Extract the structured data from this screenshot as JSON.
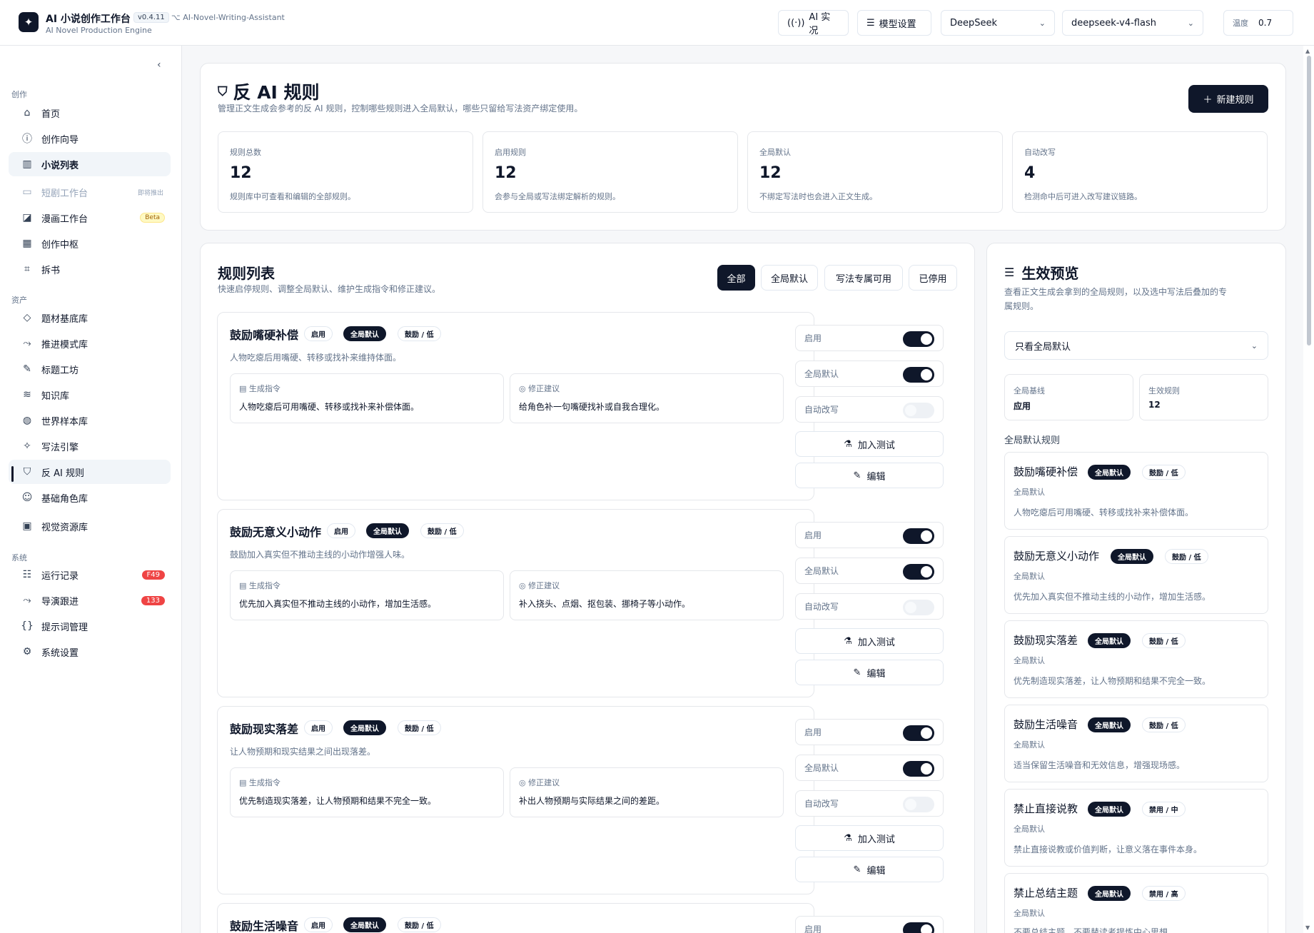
{
  "app": {
    "title": "AI 小说创作工作台",
    "version": "v0.4.11",
    "subtitle": "AI Novel Production Engine",
    "repo": "AI-Novel-Writing-Assistant"
  },
  "topbar": {
    "live_label": "AI 实况",
    "model_settings_label": "模型设置",
    "provider": "DeepSeek",
    "model": "deepseek-v4-flash",
    "temp_label": "温度",
    "temp_value": "0.7"
  },
  "sidebar": {
    "sections": {
      "create": "创作",
      "assets": "资产",
      "system": "系统"
    },
    "items": [
      {
        "label": "首页",
        "icon": "home-icon"
      },
      {
        "label": "创作向导",
        "icon": "help-circle-icon"
      },
      {
        "label": "小说列表",
        "icon": "book-open-icon",
        "active": true
      },
      {
        "label": "短剧工作台",
        "icon": "tv-icon",
        "disabled": true,
        "tag": "即将推出"
      },
      {
        "label": "漫画工作台",
        "icon": "comic-icon",
        "badge": "Beta"
      },
      {
        "label": "创作中枢",
        "icon": "grid-icon"
      },
      {
        "label": "拆书",
        "icon": "scan-icon"
      },
      {
        "label": "题材基底库",
        "icon": "tag-icon"
      },
      {
        "label": "推进模式库",
        "icon": "route-icon"
      },
      {
        "label": "标题工坊",
        "icon": "edit-icon"
      },
      {
        "label": "知识库",
        "icon": "database-icon"
      },
      {
        "label": "世界样本库",
        "icon": "globe-icon"
      },
      {
        "label": "写法引擎",
        "icon": "wand-icon"
      },
      {
        "label": "反 AI 规则",
        "icon": "shield-check-icon",
        "current": true
      },
      {
        "label": "基础角色库",
        "icon": "user-icon"
      },
      {
        "label": "视觉资源库",
        "icon": "image-icon"
      },
      {
        "label": "运行记录",
        "icon": "list-icon",
        "count": "F49"
      },
      {
        "label": "导演跟进",
        "icon": "route-icon",
        "count": "133"
      },
      {
        "label": "提示词管理",
        "icon": "braces-icon"
      },
      {
        "label": "系统设置",
        "icon": "settings-icon"
      }
    ]
  },
  "page": {
    "title": "反 AI 规则",
    "desc": "管理正文生成会参考的反 AI 规则，控制哪些规则进入全局默认，哪些只留给写法资产绑定使用。",
    "new_button": "新建规则",
    "stats": [
      {
        "label": "规则总数",
        "value": "12",
        "desc": "规则库中可查看和编辑的全部规则。"
      },
      {
        "label": "启用规则",
        "value": "12",
        "desc": "会参与全局或写法绑定解析的规则。"
      },
      {
        "label": "全局默认",
        "value": "12",
        "desc": "不绑定写法时也会进入正文生成。"
      },
      {
        "label": "自动改写",
        "value": "4",
        "desc": "检测命中后可进入改写建议链路。"
      }
    ]
  },
  "rules_list": {
    "title": "规则列表",
    "desc": "快速启停规则、调整全局默认、维护生成指令和修正建议。",
    "filters": [
      "全部",
      "全局默认",
      "写法专属可用",
      "已停用"
    ],
    "labels": {
      "gen": "生成指令",
      "fix": "修正建议",
      "enabled": "启用",
      "global": "全局默认",
      "auto": "自动改写",
      "test": "加入测试",
      "edit": "编辑"
    },
    "rules": [
      {
        "name": "鼓励嘴硬补偿",
        "status": "启用",
        "scope": "全局默认",
        "level": "鼓励 / 低",
        "desc": "人物吃瘪后用嘴硬、转移或找补来维持体面。",
        "gen": "人物吃瘪后可用嘴硬、转移或找补来补偿体面。",
        "fix": "给角色补一句嘴硬找补或自我合理化。"
      },
      {
        "name": "鼓励无意义小动作",
        "status": "启用",
        "scope": "全局默认",
        "level": "鼓励 / 低",
        "desc": "鼓励加入真实但不推动主线的小动作增强人味。",
        "gen": "优先加入真实但不推动主线的小动作，增加生活感。",
        "fix": "补入挠头、点烟、抠包装、挪椅子等小动作。"
      },
      {
        "name": "鼓励现实落差",
        "status": "启用",
        "scope": "全局默认",
        "level": "鼓励 / 低",
        "desc": "让人物预期和现实结果之间出现落差。",
        "gen": "优先制造现实落差，让人物预期和结果不完全一致。",
        "fix": "补出人物预期与实际结果之间的差距。"
      },
      {
        "name": "鼓励生活噪音",
        "status": "启用",
        "scope": "全局默认",
        "level": "鼓励 / 低"
      }
    ]
  },
  "preview": {
    "title": "生效预览",
    "desc_line1": "查看正文生成会拿到的全局规则，以及选中写法后叠加的专",
    "desc_line2": "属规则。",
    "select_value": "只看全局默认",
    "stats": [
      {
        "label": "全局基线",
        "value": "应用"
      },
      {
        "label": "生效规则",
        "value": "12"
      }
    ],
    "subtitle": "全局默认规则",
    "cards": [
      {
        "name": "鼓励嘴硬补偿",
        "scope": "全局默认",
        "level": "鼓励 / 低",
        "category": "全局默认",
        "text": "人物吃瘪后可用嘴硬、转移或找补来补偿体面。"
      },
      {
        "name": "鼓励无意义小动作",
        "scope": "全局默认",
        "level": "鼓励 / 低",
        "category": "全局默认",
        "text": "优先加入真实但不推动主线的小动作，增加生活感。"
      },
      {
        "name": "鼓励现实落差",
        "scope": "全局默认",
        "level": "鼓励 / 低",
        "category": "全局默认",
        "text": "优先制造现实落差，让人物预期和结果不完全一致。"
      },
      {
        "name": "鼓励生活噪音",
        "scope": "全局默认",
        "level": "鼓励 / 低",
        "category": "全局默认",
        "text": "适当保留生活噪音和无效信息，增强现场感。"
      },
      {
        "name": "禁止直接说教",
        "scope": "全局默认",
        "level": "禁用 / 中",
        "category": "全局默认",
        "text": "禁止直接说教或价值判断，让意义落在事件本身。"
      },
      {
        "name": "禁止总结主题",
        "scope": "全局默认",
        "level": "禁用 / 高",
        "category": "全局默认",
        "text": "不要总结主题，不要替读者提炼中心思想。"
      }
    ]
  }
}
